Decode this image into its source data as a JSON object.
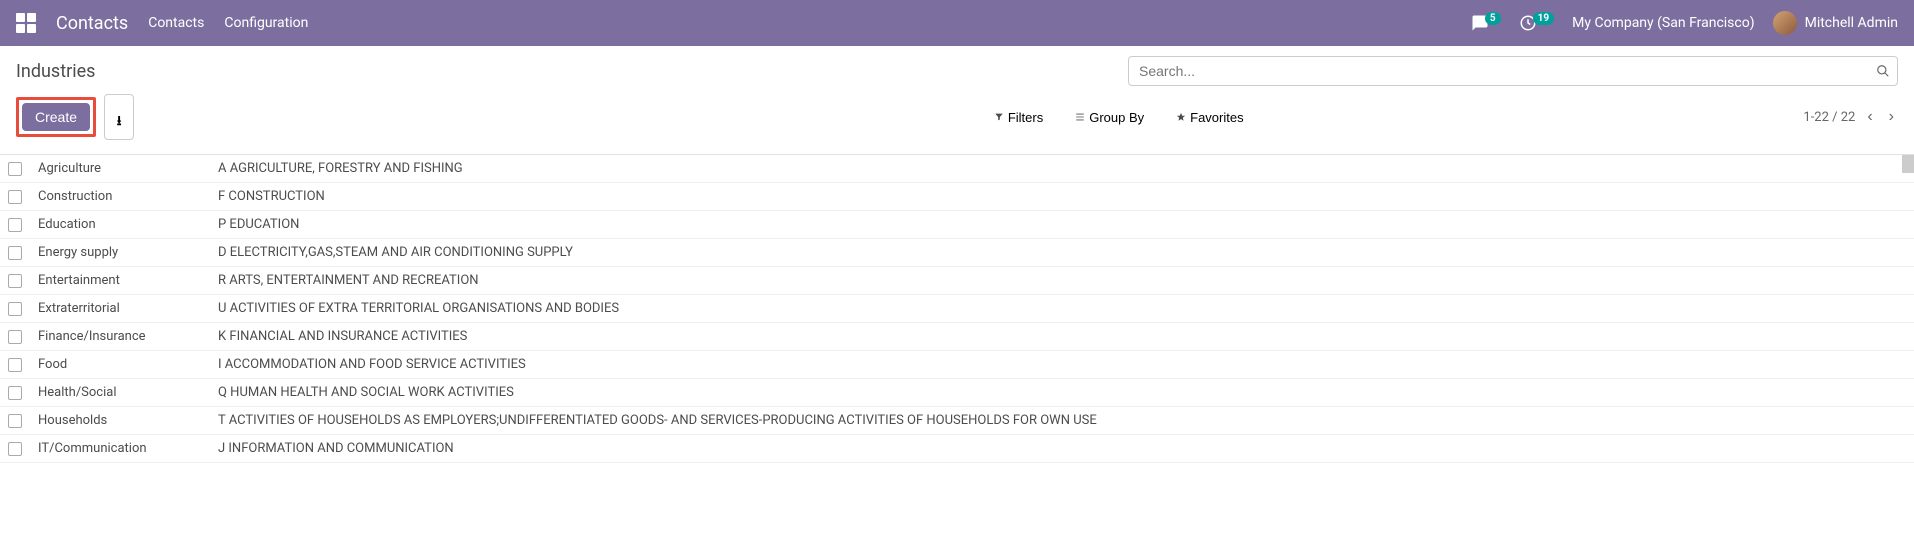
{
  "navbar": {
    "app_title": "Contacts",
    "links": [
      "Contacts",
      "Configuration"
    ],
    "messages_badge": "5",
    "activities_badge": "19",
    "company": "My Company (San Francisco)",
    "user": "Mitchell Admin"
  },
  "breadcrumb": "Industries",
  "search": {
    "placeholder": "Search..."
  },
  "buttons": {
    "create": "Create",
    "filters": "Filters",
    "group_by": "Group By",
    "favorites": "Favorites"
  },
  "pager": {
    "range": "1-22 / 22"
  },
  "rows": [
    {
      "name": "Agriculture",
      "full": "A AGRICULTURE, FORESTRY AND FISHING"
    },
    {
      "name": "Construction",
      "full": "F CONSTRUCTION"
    },
    {
      "name": "Education",
      "full": "P EDUCATION"
    },
    {
      "name": "Energy supply",
      "full": "D ELECTRICITY,GAS,STEAM AND AIR CONDITIONING SUPPLY"
    },
    {
      "name": "Entertainment",
      "full": "R ARTS, ENTERTAINMENT AND RECREATION"
    },
    {
      "name": "Extraterritorial",
      "full": "U ACTIVITIES OF EXTRA TERRITORIAL ORGANISATIONS AND BODIES"
    },
    {
      "name": "Finance/Insurance",
      "full": "K FINANCIAL AND INSURANCE ACTIVITIES"
    },
    {
      "name": "Food",
      "full": "I ACCOMMODATION AND FOOD SERVICE ACTIVITIES"
    },
    {
      "name": "Health/Social",
      "full": "Q HUMAN HEALTH AND SOCIAL WORK ACTIVITIES"
    },
    {
      "name": "Households",
      "full": "T ACTIVITIES OF HOUSEHOLDS AS EMPLOYERS;UNDIFFERENTIATED GOODS- AND SERVICES-PRODUCING ACTIVITIES OF HOUSEHOLDS FOR OWN USE"
    },
    {
      "name": "IT/Communication",
      "full": "J INFORMATION AND COMMUNICATION"
    }
  ]
}
